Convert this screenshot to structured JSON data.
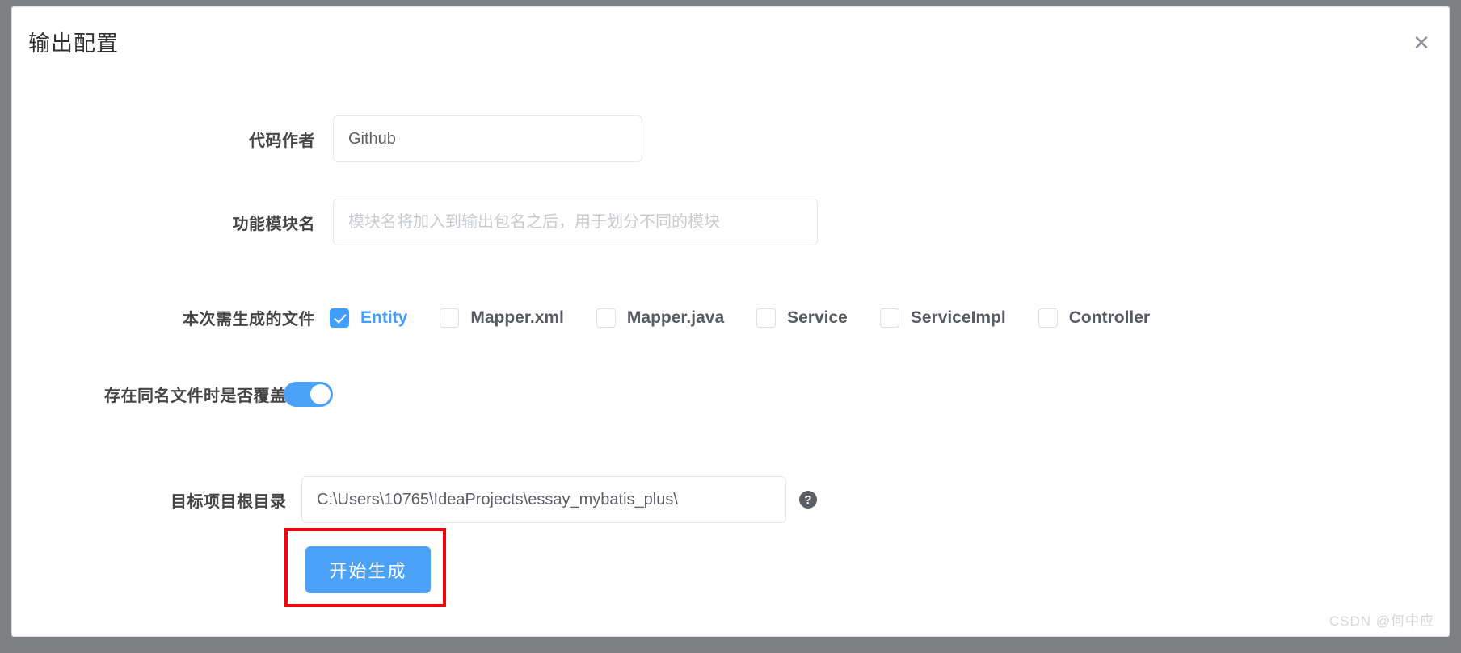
{
  "dialog": {
    "title": "输出配置",
    "close_icon": "close-icon",
    "close_label": "✕"
  },
  "form": {
    "author": {
      "label": "代码作者",
      "value": "Github",
      "placeholder": ""
    },
    "module": {
      "label": "功能模块名",
      "value": "",
      "placeholder": "模块名将加入到输出包名之后，用于划分不同的模块"
    },
    "files": {
      "label": "本次需生成的文件",
      "options": [
        {
          "label": "Entity",
          "checked": true
        },
        {
          "label": "Mapper.xml",
          "checked": false
        },
        {
          "label": "Mapper.java",
          "checked": false
        },
        {
          "label": "Service",
          "checked": false
        },
        {
          "label": "ServiceImpl",
          "checked": false
        },
        {
          "label": "Controller",
          "checked": false
        }
      ]
    },
    "overwrite": {
      "label": "存在同名文件时是否覆盖",
      "on": true
    },
    "directory": {
      "label": "目标项目根目录",
      "value": "C:\\Users\\10765\\IdeaProjects\\essay_mybatis_plus\\",
      "placeholder": "",
      "help_icon": "help-icon",
      "help_glyph": "?"
    },
    "submit": {
      "label": "开始生成"
    }
  },
  "watermark": {
    "text": "CSDN @何中应"
  },
  "colors": {
    "accent": "#4ba2f8",
    "checkbox_checked": "#409eff",
    "annotation": "#f6000a",
    "backdrop": "#7f8083",
    "label": "#454545"
  }
}
